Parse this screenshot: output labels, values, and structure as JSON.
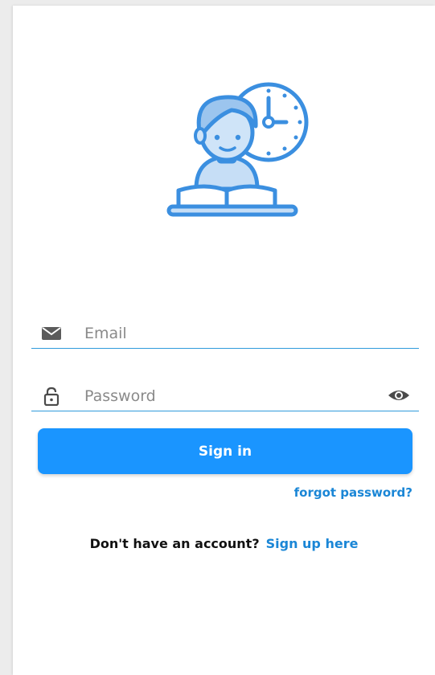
{
  "login": {
    "email": {
      "placeholder": "Email",
      "value": ""
    },
    "password": {
      "placeholder": "Password",
      "value": ""
    },
    "signin_label": "Sign in",
    "forgot_label": "forgot password?",
    "signup_prompt": "Don't have an account?",
    "signup_link": "Sign up here"
  },
  "icons": {
    "illustration": "student-reading-book-clock-illustration",
    "email": "envelope-icon",
    "password": "padlock-icon",
    "toggle": "eye-icon"
  },
  "colors": {
    "accent": "#1a95ff",
    "link": "#1a86d6",
    "underline": "#2f9bdc",
    "illustration": "#3b8fe0"
  }
}
